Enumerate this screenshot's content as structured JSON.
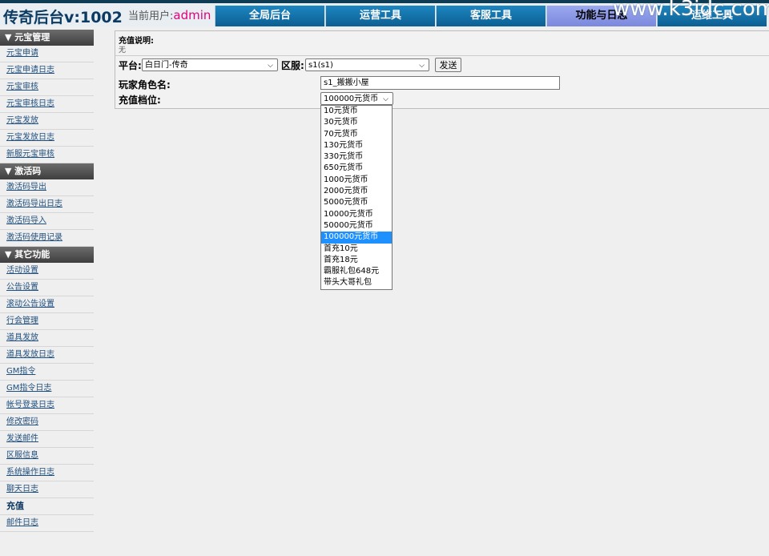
{
  "header": {
    "brand": "传奇后台v:1002",
    "user_label": "当前用户:",
    "username": "admin",
    "watermark": "www.k3idc.com",
    "tabs": [
      "全局后台",
      "运营工具",
      "客服工具",
      "功能与日志",
      "运维工具"
    ],
    "active_tab": "功能与日志"
  },
  "sidebar": {
    "sections": [
      {
        "title": "▼ 元宝管理",
        "items": [
          "元宝申请",
          "元宝申请日志",
          "元宝审核",
          "元宝审核日志",
          "元宝发放",
          "元宝发放日志",
          "新服元宝审核"
        ]
      },
      {
        "title": "▼ 激活码",
        "items": [
          "激活码导出",
          "激活码导出日志",
          "激活码导入",
          "激活码使用记录"
        ]
      },
      {
        "title": "▼ 其它功能",
        "items": [
          "活动设置",
          "公告设置",
          "滚动公告设置",
          "行会管理",
          "道具发放",
          "道具发放日志",
          "GM指令",
          "GM指令日志",
          "帐号登录日志",
          "修改密码",
          "发送邮件",
          "区服信息",
          "系统操作日志",
          "聊天日志",
          "充值",
          "邮件日志"
        ]
      }
    ],
    "current": "充值"
  },
  "main": {
    "desc_title": "充值说明:",
    "desc_text": "无",
    "platform_label": "平台:",
    "platform_value": "白日门-传奇",
    "server_label": "区服:",
    "server_value": "s1(s1)",
    "send_label": "发送",
    "role_label": "玩家角色名:",
    "role_value": "s1_搬搬小屋",
    "tier_label": "充值档位:",
    "tier_value": "100000元货币",
    "tier_options": [
      "10元货币",
      "30元货币",
      "70元货币",
      "130元货币",
      "330元货币",
      "650元货币",
      "1000元货币",
      "2000元货币",
      "5000元货币",
      "10000元货币",
      "50000元货币",
      "100000元货币",
      "首充10元",
      "首充18元",
      "霸服礼包648元",
      "带头大哥礼包"
    ]
  }
}
